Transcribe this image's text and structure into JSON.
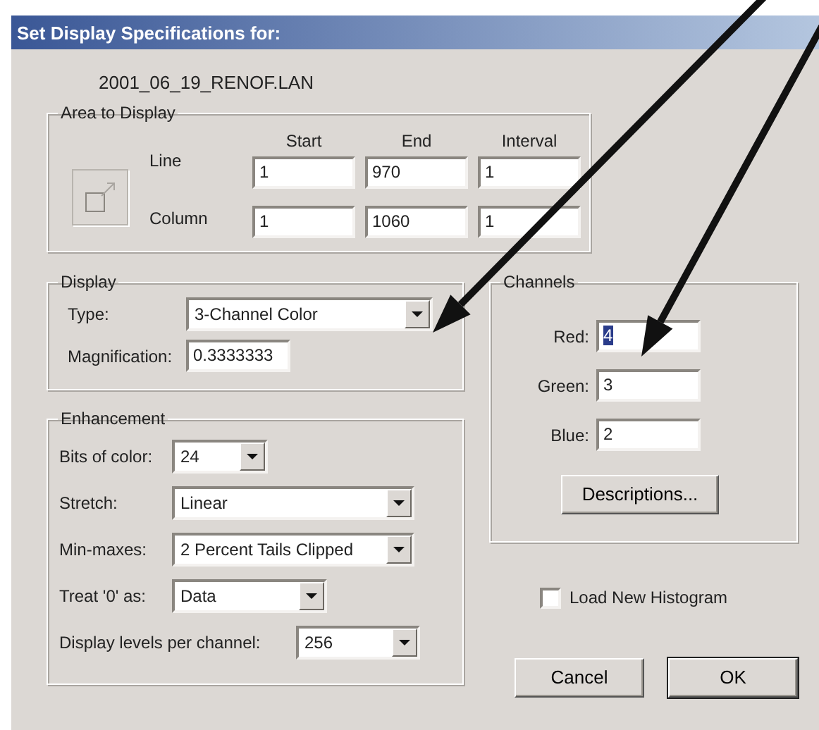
{
  "window": {
    "title": "Set Display Specifications for:"
  },
  "filename": "2001_06_19_RENOF.LAN",
  "area_to_display": {
    "title": "Area to Display",
    "columns": [
      "Start",
      "End",
      "Interval"
    ],
    "rows": [
      {
        "label": "Line",
        "values": [
          "1",
          "970",
          "1"
        ]
      },
      {
        "label": "Column",
        "values": [
          "1",
          "1060",
          "1"
        ]
      }
    ]
  },
  "display": {
    "title": "Display",
    "fields": [
      {
        "kind": "dropdown",
        "label": "Type:",
        "value": "3-Channel Color"
      },
      {
        "kind": "input",
        "label": "Magnification:",
        "value": "0.3333333"
      }
    ]
  },
  "enhancement": {
    "title": "Enhancement",
    "fields": [
      {
        "kind": "dropdown",
        "label": "Bits of color:",
        "value": "24"
      },
      {
        "kind": "dropdown",
        "label": "Stretch:",
        "value": "Linear"
      },
      {
        "kind": "dropdown",
        "label": "Min-maxes:",
        "value": "2 Percent Tails Clipped"
      },
      {
        "kind": "dropdown",
        "label": "Treat '0' as:",
        "value": "Data"
      },
      {
        "kind": "dropdown",
        "label": "Display levels per channel:",
        "value": "256"
      }
    ]
  },
  "channels": {
    "title": "Channels",
    "fields": [
      {
        "label": "Red:",
        "value": "4",
        "selected": true
      },
      {
        "label": "Green:",
        "value": "3",
        "selected": false
      },
      {
        "label": "Blue:",
        "value": "2",
        "selected": false
      }
    ],
    "button": "Descriptions..."
  },
  "load_new_histogram": {
    "label": "Load New Histogram",
    "checked": false
  },
  "buttons": [
    {
      "label": "Cancel",
      "default": false
    },
    {
      "label": "OK",
      "default": true
    }
  ]
}
